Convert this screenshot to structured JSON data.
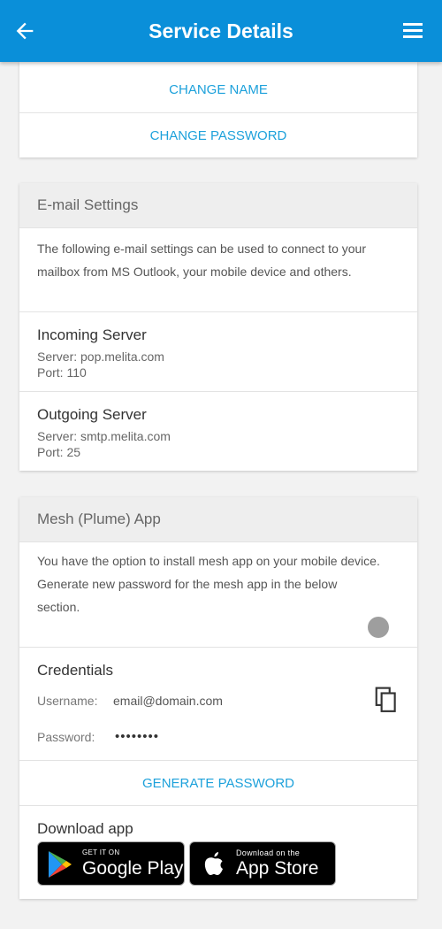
{
  "header": {
    "title": "Service Details",
    "back_icon": "back-arrow-icon",
    "menu_icon": "menu-icon"
  },
  "account": {
    "change_name": "CHANGE NAME",
    "change_password": "CHANGE PASSWORD"
  },
  "email_settings": {
    "title": "E-mail Settings",
    "description": "The following e-mail settings can be used to connect to your mailbox from MS Outlook, your mobile device and others.",
    "incoming": {
      "title": "Incoming Server",
      "server": "Server: pop.melita.com",
      "port": "Port: 110"
    },
    "outgoing": {
      "title": "Outgoing Server",
      "server": "Server: smtp.melita.com",
      "port": "Port: 25"
    }
  },
  "mesh": {
    "title": "Mesh (Plume) App",
    "desc_line1": "You have the option to install mesh app on your mobile device.",
    "desc_line2": "Generate new password for the mesh app in the below section.",
    "credentials": {
      "title": "Credentials",
      "username_label": "Username:",
      "username_value": "email@domain.com",
      "password_label": "Password:",
      "password_value": "••••••••"
    },
    "generate_password": "GENERATE PASSWORD",
    "download": {
      "title": "Download app",
      "google_small": "GET IT ON",
      "google_big": "Google Play",
      "apple_small": "Download on the",
      "apple_big": "App Store"
    }
  },
  "colors": {
    "accent": "#0a8fd9",
    "link": "#1da1db",
    "background": "#f2f2f2"
  }
}
